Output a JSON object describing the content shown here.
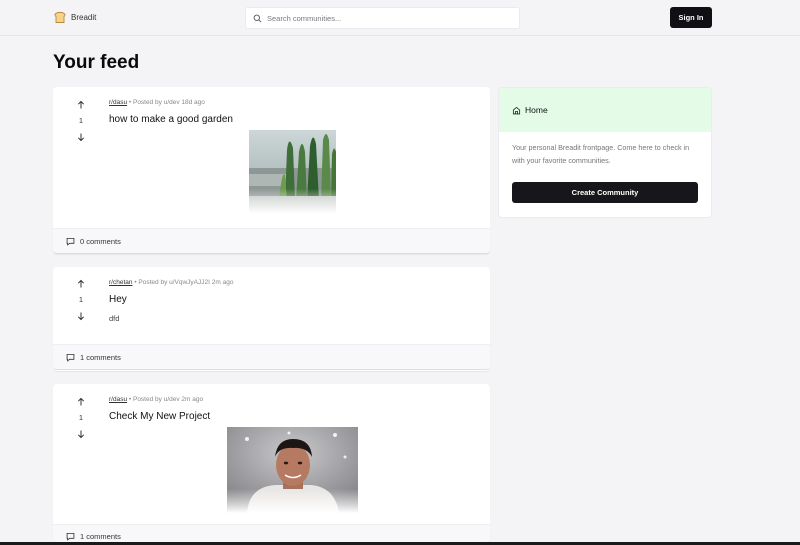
{
  "navbar": {
    "brand": "Breadit",
    "search_placeholder": "Search communities...",
    "signin_label": "Sign In"
  },
  "page_title": "Your feed",
  "posts": [
    {
      "subreddit": "r/dasu",
      "posted_by": "Posted by u/dev 18d ago",
      "votes": "1",
      "title": "how to make a good garden",
      "body": "",
      "image": "garden-photo",
      "comments": "0 comments"
    },
    {
      "subreddit": "r/chetan",
      "posted_by": "Posted by u/VqwJyAJJ2I 2m ago",
      "votes": "1",
      "title": "Hey",
      "body": "dfd",
      "image": "",
      "comments": "1 comments"
    },
    {
      "subreddit": "r/dasu",
      "posted_by": "Posted by u/dev 2m ago",
      "votes": "1",
      "title": "Check My New Project",
      "body": "",
      "image": "portrait-photo",
      "comments": "1 comments"
    }
  ],
  "sidebar": {
    "title": "Home",
    "description": "Your personal Breadit frontpage. Come here to check in with your favorite communities.",
    "button_label": "Create Community"
  },
  "colors": {
    "accent_dark": "#101014",
    "home_header_bg": "#e3fbe7",
    "page_bg": "#f4f4f6"
  }
}
